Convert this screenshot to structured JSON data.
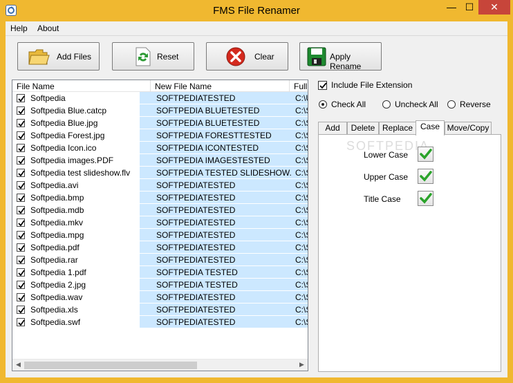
{
  "window": {
    "title": "FMS File Renamer",
    "minimize_glyph": "—",
    "maximize_glyph": "☐",
    "close_glyph": "✕"
  },
  "menu": {
    "items": [
      "Help",
      "About"
    ]
  },
  "toolbar": {
    "add_files": "Add Files",
    "reset": "Reset",
    "clear": "Clear",
    "apply_rename": "Apply Rename"
  },
  "filelist": {
    "headers": [
      "File Name",
      "New File Name",
      "Full P"
    ],
    "rows": [
      {
        "name": "Softpedia",
        "new": "SOFTPEDIATESTED",
        "path": "C:\\U",
        "checked": true
      },
      {
        "name": "Softpedia Blue.catcp",
        "new": "SOFTPEDIA BLUETESTED",
        "path": "C:\\S",
        "checked": true
      },
      {
        "name": "Softpedia Blue.jpg",
        "new": "SOFTPEDIA BLUETESTED",
        "path": "C:\\S",
        "checked": true
      },
      {
        "name": "Softpedia Forest.jpg",
        "new": "SOFTPEDIA FORESTTESTED",
        "path": "C:\\S",
        "checked": true
      },
      {
        "name": "Softpedia Icon.ico",
        "new": "SOFTPEDIA ICONTESTED",
        "path": "C:\\S",
        "checked": true
      },
      {
        "name": "Softpedia images.PDF",
        "new": "SOFTPEDIA IMAGESTESTED",
        "path": "C:\\S",
        "checked": true
      },
      {
        "name": "Softpedia test slideshow.flv",
        "new": "SOFTPEDIA TESTED SLIDESHOW...",
        "path": "C:\\S",
        "checked": true
      },
      {
        "name": "Softpedia.avi",
        "new": "SOFTPEDIATESTED",
        "path": "C:\\S",
        "checked": true
      },
      {
        "name": "Softpedia.bmp",
        "new": "SOFTPEDIATESTED",
        "path": "C:\\S",
        "checked": true
      },
      {
        "name": "Softpedia.mdb",
        "new": "SOFTPEDIATESTED",
        "path": "C:\\S",
        "checked": true
      },
      {
        "name": "Softpedia.mkv",
        "new": "SOFTPEDIATESTED",
        "path": "C:\\S",
        "checked": true
      },
      {
        "name": "Softpedia.mpg",
        "new": "SOFTPEDIATESTED",
        "path": "C:\\S",
        "checked": true
      },
      {
        "name": "Softpedia.pdf",
        "new": "SOFTPEDIATESTED",
        "path": "C:\\S",
        "checked": true
      },
      {
        "name": "Softpedia.rar",
        "new": "SOFTPEDIATESTED",
        "path": "C:\\S",
        "checked": true
      },
      {
        "name": "Softpedia 1.pdf",
        "new": "SOFTPEDIA TESTED",
        "path": "C:\\S",
        "checked": true
      },
      {
        "name": "Softpedia 2.jpg",
        "new": "SOFTPEDIA TESTED",
        "path": "C:\\S",
        "checked": true
      },
      {
        "name": "Softpedia.wav",
        "new": "SOFTPEDIATESTED",
        "path": "C:\\S",
        "checked": true
      },
      {
        "name": "Softpedia.xls",
        "new": "SOFTPEDIATESTED",
        "path": "C:\\S",
        "checked": true
      },
      {
        "name": "Softpedia.swf",
        "new": "SOFTPEDIATESTED",
        "path": "C:\\S",
        "checked": true
      }
    ]
  },
  "options": {
    "include_extension": "Include File Extension",
    "check_all": "Check All",
    "uncheck_all": "Uncheck All",
    "reverse": "Reverse"
  },
  "tabs": [
    "Add",
    "Delete",
    "Replace",
    "Case",
    "Move/Copy"
  ],
  "case_panel": {
    "lower": "Lower Case",
    "upper": "Upper Case",
    "title": "Title Case",
    "watermark": "SOFTPEDIA"
  },
  "colors": {
    "title_bar": "#f0b830",
    "selection": "#cce8ff",
    "close_button": "#c7453a"
  }
}
